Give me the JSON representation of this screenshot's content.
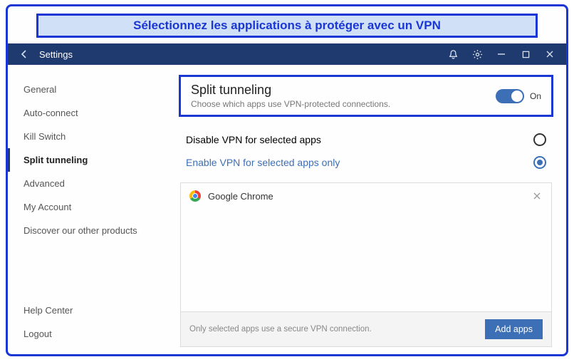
{
  "banner": {
    "text": "Sélectionnez les applications à protéger avec un VPN"
  },
  "titlebar": {
    "title": "Settings"
  },
  "sidebar": {
    "items": [
      {
        "label": "General"
      },
      {
        "label": "Auto-connect"
      },
      {
        "label": "Kill Switch"
      },
      {
        "label": "Split tunneling"
      },
      {
        "label": "Advanced"
      },
      {
        "label": "My Account"
      },
      {
        "label": "Discover our other products"
      }
    ],
    "footer": [
      {
        "label": "Help Center"
      },
      {
        "label": "Logout"
      }
    ],
    "active_index": 3
  },
  "feature": {
    "title": "Split tunneling",
    "subtitle": "Choose which apps use VPN-protected connections.",
    "toggle_label": "On",
    "toggle_on": true
  },
  "options": {
    "items": [
      {
        "label": "Disable VPN for selected apps"
      },
      {
        "label": "Enable VPN for selected apps only"
      }
    ],
    "selected_index": 1
  },
  "apps": {
    "list": [
      {
        "name": "Google Chrome",
        "icon": "chrome-icon"
      }
    ],
    "footer_text": "Only selected apps use a secure VPN connection.",
    "add_button": "Add apps"
  }
}
